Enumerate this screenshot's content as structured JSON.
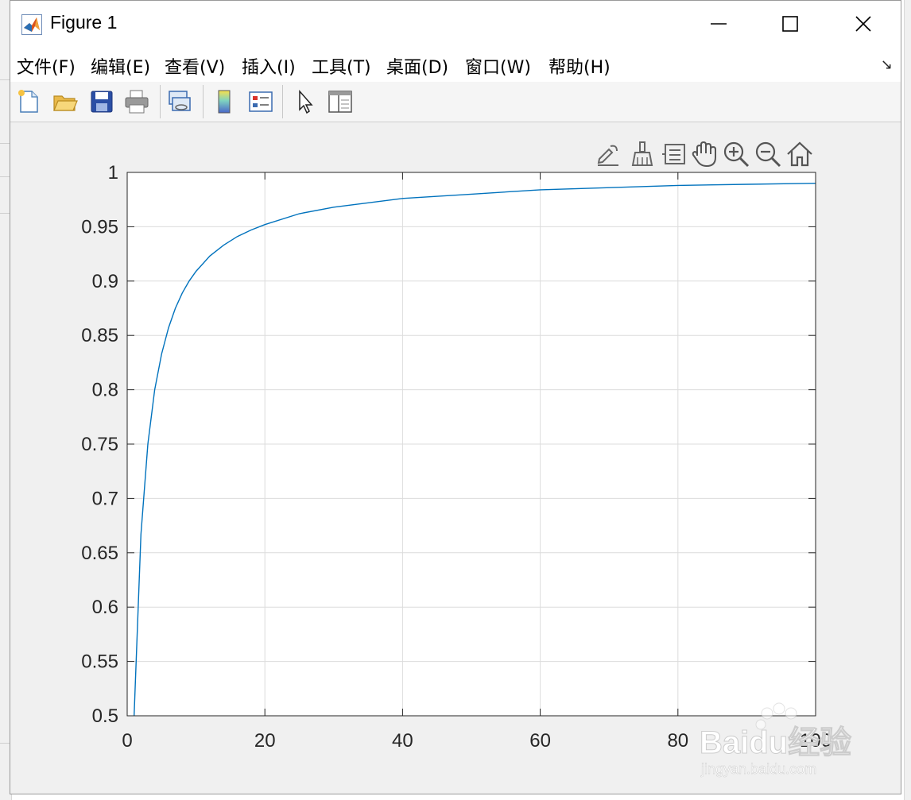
{
  "window": {
    "title": "Figure 1",
    "menu": [
      {
        "label": "文件(F)"
      },
      {
        "label": "编辑(E)"
      },
      {
        "label": "查看(V)"
      },
      {
        "label": "插入(I)"
      },
      {
        "label": "工具(T)"
      },
      {
        "label": "桌面(D)"
      },
      {
        "label": "窗口(W)"
      },
      {
        "label": "帮助(H)"
      }
    ],
    "toolbar_icons": [
      "new-figure-icon",
      "open-file-icon",
      "save-icon",
      "print-icon",
      "link-plot-icon",
      "colorbar-icon",
      "legend-icon",
      "pointer-icon",
      "property-inspector-icon"
    ],
    "axes_toolbar_icons": [
      "brush-edit-icon",
      "data-brush-icon",
      "data-tips-icon",
      "pan-hand-icon",
      "zoom-in-icon",
      "zoom-out-icon",
      "home-icon"
    ]
  },
  "watermark": {
    "text": "Baidu经验",
    "sub": "jingyan.baidu.com"
  },
  "colors": {
    "line": "#0072BD",
    "grid": "#dcdcdc",
    "axis": "#262626",
    "figure_bg": "#f0f0f0"
  },
  "chart_data": {
    "type": "line",
    "title": "",
    "xlabel": "",
    "ylabel": "",
    "xlim": [
      0,
      100
    ],
    "ylim": [
      0.5,
      1
    ],
    "xticks": [
      0,
      20,
      40,
      60,
      80,
      100
    ],
    "yticks": [
      0.5,
      0.55,
      0.6,
      0.65,
      0.7,
      0.75,
      0.8,
      0.85,
      0.9,
      0.95,
      1
    ],
    "ytick_labels": [
      "0.5",
      "0.55",
      "0.6",
      "0.65",
      "0.7",
      "0.75",
      "0.8",
      "0.85",
      "0.9",
      "0.95",
      "1"
    ],
    "xtick_labels": [
      "0",
      "20",
      "40",
      "60",
      "80",
      "100"
    ],
    "grid": true,
    "series": [
      {
        "x": [
          1,
          2,
          3,
          4,
          5,
          6,
          7,
          8,
          9,
          10,
          12,
          14,
          16,
          18,
          20,
          25,
          30,
          35,
          40,
          50,
          60,
          70,
          80,
          90,
          100
        ],
        "y": [
          0.5,
          0.667,
          0.75,
          0.8,
          0.833,
          0.857,
          0.875,
          0.889,
          0.9,
          0.909,
          0.923,
          0.933,
          0.941,
          0.947,
          0.952,
          0.962,
          0.968,
          0.972,
          0.976,
          0.98,
          0.984,
          0.986,
          0.988,
          0.989,
          0.99
        ]
      }
    ]
  }
}
